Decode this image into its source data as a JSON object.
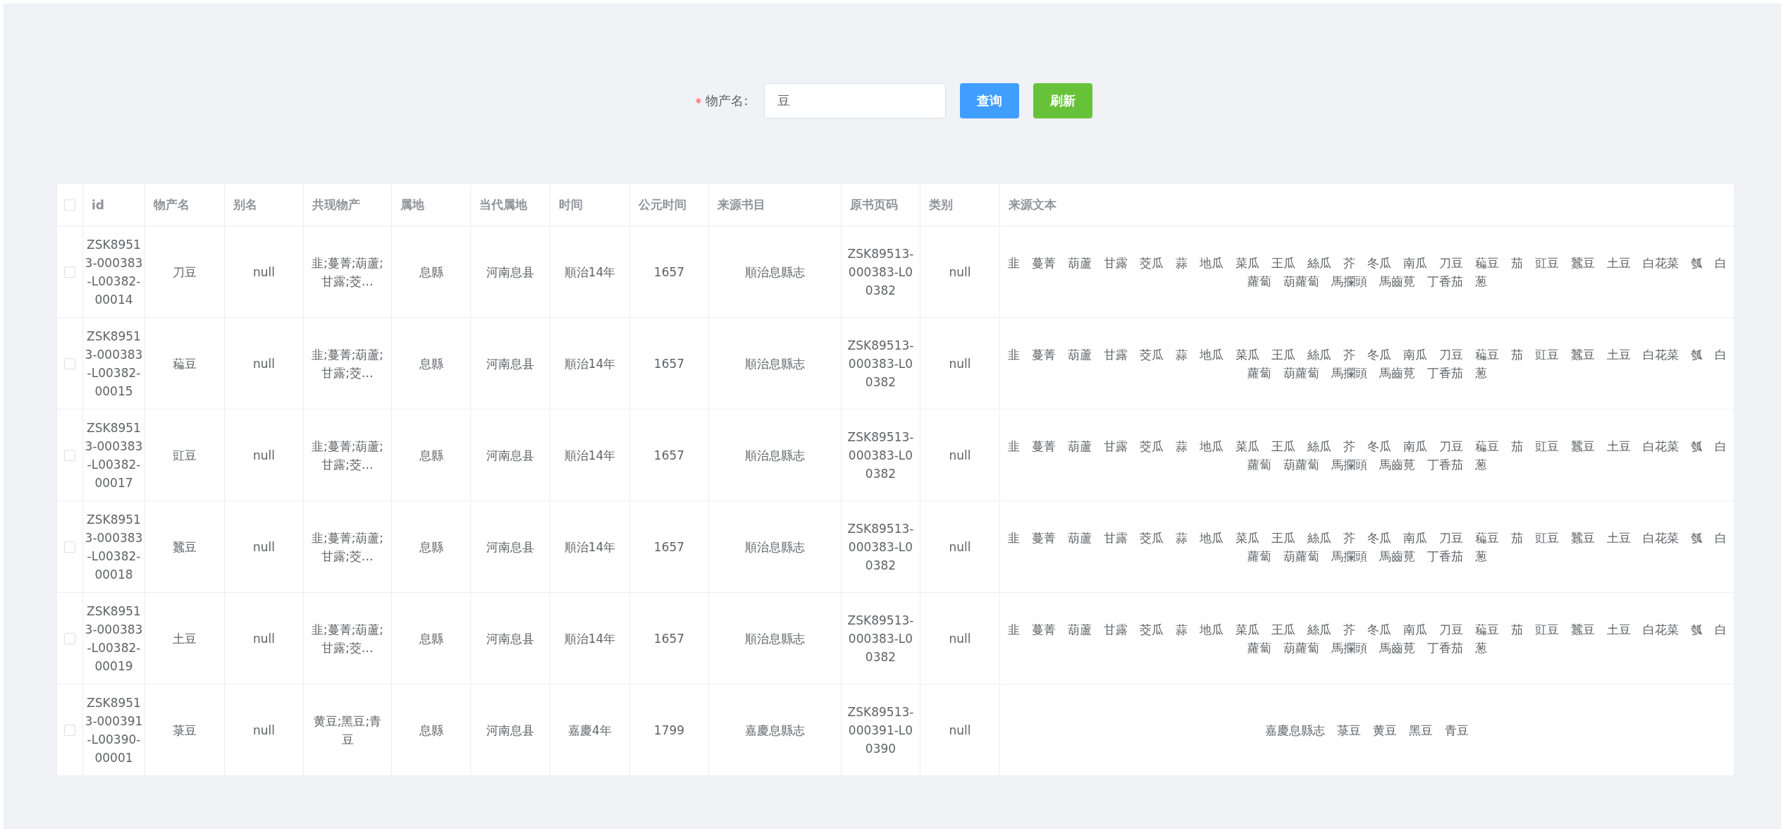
{
  "search_form": {
    "required": true,
    "label": "物产名:",
    "field": {
      "value": "豆"
    },
    "buttons": [
      {
        "kind": "primary",
        "label": "查询"
      },
      {
        "kind": "success",
        "label": "刷新"
      }
    ]
  },
  "table": {
    "select_all": {
      "checked": false
    },
    "columns": [
      "id",
      "物产名",
      "别名",
      "共现物产",
      "属地",
      "当代属地",
      "时间",
      "公元时间",
      "来源书目",
      "原书页码",
      "类别",
      "来源文本"
    ],
    "rows": [
      {
        "checked": false,
        "cells": [
          "ZSK89513-000383-L00382-00014",
          "刀豆",
          "null",
          "韭;蔓菁;葫蘆;甘露;茭…",
          "息縣",
          "河南息县",
          "順治14年",
          "1657",
          "順治息縣志",
          "ZSK89513-000383-L00382",
          "null",
          "韭　蔓菁　葫蘆　甘露　茭瓜　蒜　地瓜　菜瓜　王瓜　絲瓜　芥　冬瓜　南瓜　刀豆　藊豆　茄　豇豆　蠶豆　土豆　白花菜　瓠　白蘿蔔　葫蘿蔔　馬攔頭　馬齒莧　丁香茄　葱"
        ]
      },
      {
        "checked": false,
        "cells": [
          "ZSK89513-000383-L00382-00015",
          "藊豆",
          "null",
          "韭;蔓菁;葫蘆;甘露;茭…",
          "息縣",
          "河南息县",
          "順治14年",
          "1657",
          "順治息縣志",
          "ZSK89513-000383-L00382",
          "null",
          "韭　蔓菁　葫蘆　甘露　茭瓜　蒜　地瓜　菜瓜　王瓜　絲瓜　芥　冬瓜　南瓜　刀豆　藊豆　茄　豇豆　蠶豆　土豆　白花菜　瓠　白蘿蔔　葫蘿蔔　馬攔頭　馬齒莧　丁香茄　葱"
        ]
      },
      {
        "checked": false,
        "cells": [
          "ZSK89513-000383-L00382-00017",
          "豇豆",
          "null",
          "韭;蔓菁;葫蘆;甘露;茭…",
          "息縣",
          "河南息县",
          "順治14年",
          "1657",
          "順治息縣志",
          "ZSK89513-000383-L00382",
          "null",
          "韭　蔓菁　葫蘆　甘露　茭瓜　蒜　地瓜　菜瓜　王瓜　絲瓜　芥　冬瓜　南瓜　刀豆　藊豆　茄　豇豆　蠶豆　土豆　白花菜　瓠　白蘿蔔　葫蘿蔔　馬攔頭　馬齒莧　丁香茄　葱"
        ]
      },
      {
        "checked": false,
        "cells": [
          "ZSK89513-000383-L00382-00018",
          "蠶豆",
          "null",
          "韭;蔓菁;葫蘆;甘露;茭…",
          "息縣",
          "河南息县",
          "順治14年",
          "1657",
          "順治息縣志",
          "ZSK89513-000383-L00382",
          "null",
          "韭　蔓菁　葫蘆　甘露　茭瓜　蒜　地瓜　菜瓜　王瓜　絲瓜　芥　冬瓜　南瓜　刀豆　藊豆　茄　豇豆　蠶豆　土豆　白花菜　瓠　白蘿蔔　葫蘿蔔　馬攔頭　馬齒莧　丁香茄　葱"
        ]
      },
      {
        "checked": false,
        "cells": [
          "ZSK89513-000383-L00382-00019",
          "土豆",
          "null",
          "韭;蔓菁;葫蘆;甘露;茭…",
          "息縣",
          "河南息县",
          "順治14年",
          "1657",
          "順治息縣志",
          "ZSK89513-000383-L00382",
          "null",
          "韭　蔓菁　葫蘆　甘露　茭瓜　蒜　地瓜　菜瓜　王瓜　絲瓜　芥　冬瓜　南瓜　刀豆　藊豆　茄　豇豆　蠶豆　土豆　白花菜　瓠　白蘿蔔　葫蘿蔔　馬攔頭　馬齒莧　丁香茄　葱"
        ]
      },
      {
        "checked": false,
        "cells": [
          "ZSK89513-000391-L00390-00001",
          "菉豆",
          "null",
          "黄豆;黑豆;青豆",
          "息縣",
          "河南息县",
          "嘉慶4年",
          "1799",
          "嘉慶息縣志",
          "ZSK89513-000391-L00390",
          "null",
          "嘉慶息縣志　菉豆　黄豆　黑豆　青豆"
        ]
      }
    ]
  }
}
